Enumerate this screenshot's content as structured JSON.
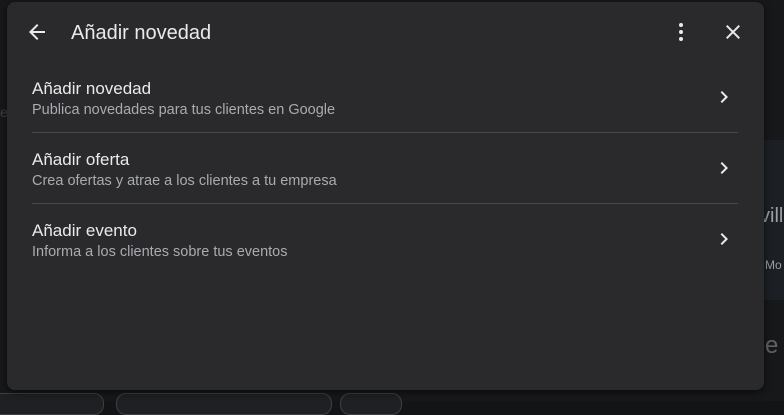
{
  "header": {
    "title": "Añadir novedad",
    "back_icon": "arrow-left-icon",
    "more_icon": "more-vert-icon",
    "close_icon": "close-icon"
  },
  "items": [
    {
      "title": "Añadir novedad",
      "subtitle": "Publica novedades para tus clientes en Google",
      "icon": "chevron-right-icon"
    },
    {
      "title": "Añadir oferta",
      "subtitle": "Crea ofertas y atrae a los clientes a tu empresa",
      "icon": "chevron-right-icon"
    },
    {
      "title": "Añadir evento",
      "subtitle": "Informa a los clientes sobre tus eventos",
      "icon": "chevron-right-icon"
    }
  ],
  "background": {
    "map_text_1": "vill",
    "map_text_2": "Mo",
    "map_text_3": "e",
    "left_text": "e"
  },
  "colors": {
    "dialog_bg": "#2a2a2c",
    "text_primary": "#e8eaed",
    "text_secondary": "#a8abb0",
    "divider": "#4a4a4d"
  }
}
